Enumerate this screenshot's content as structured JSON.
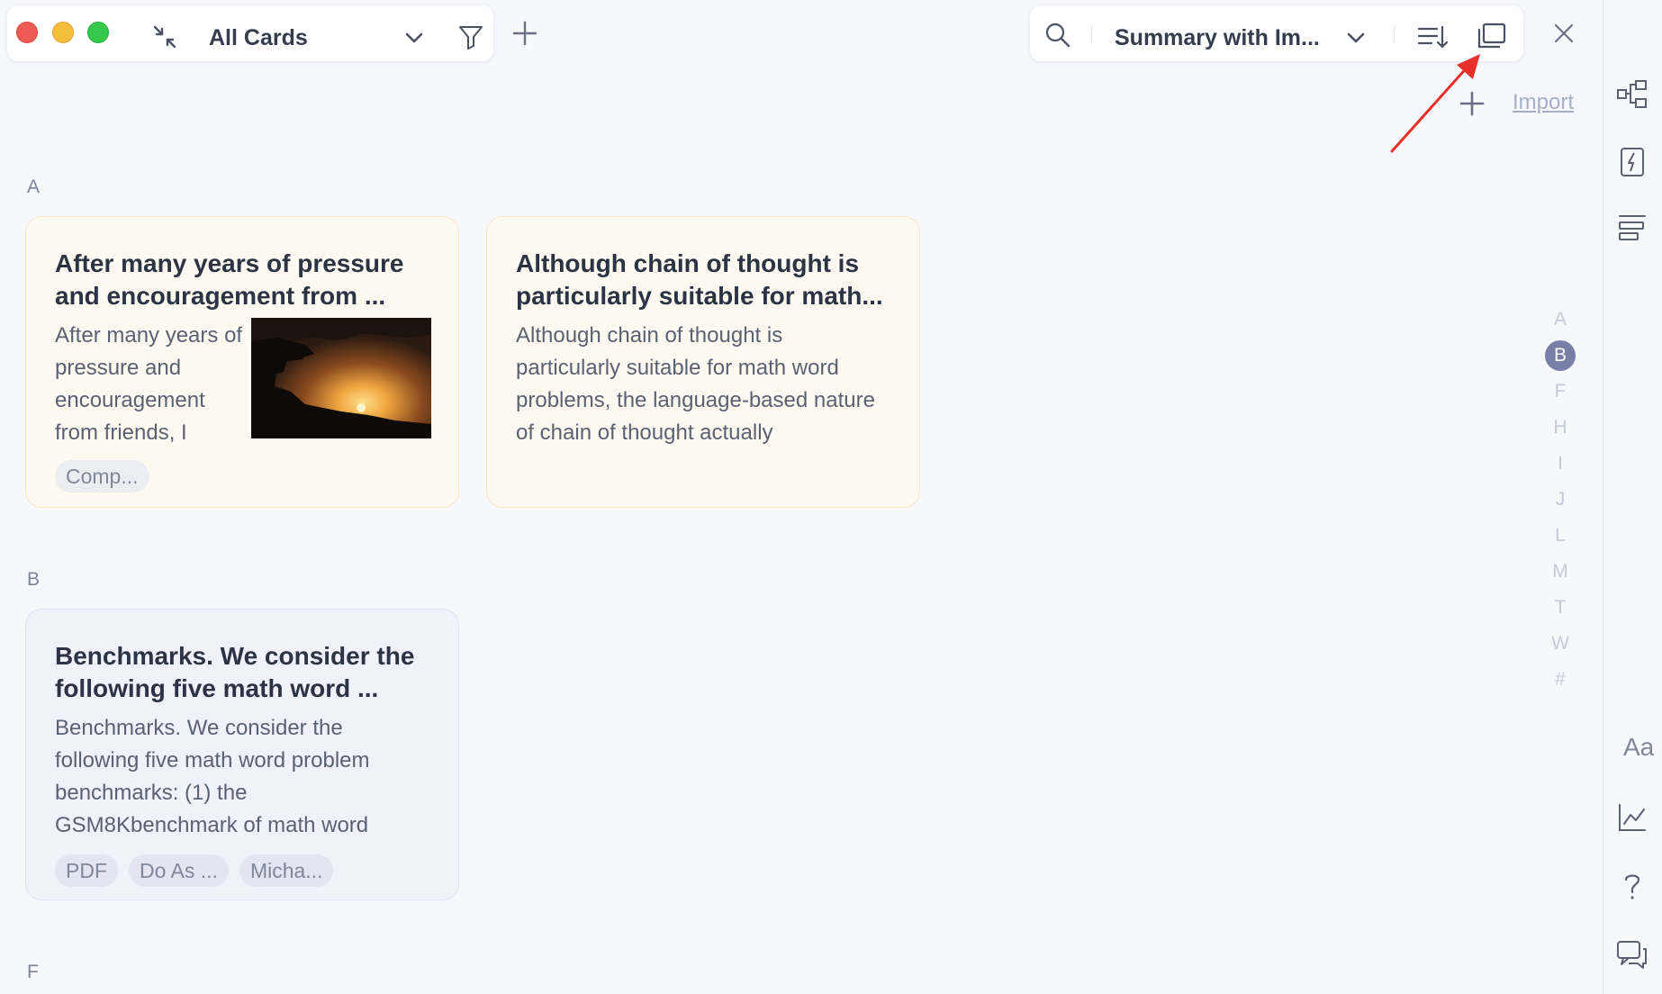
{
  "toolbar_left": {
    "view_title": "All Cards"
  },
  "toolbar_right": {
    "layout_title": "Summary with Im..."
  },
  "actions": {
    "import_label": "Import"
  },
  "sections": [
    {
      "letter": "A",
      "cards": [
        {
          "title": "After many years of pressure and encouragement from ...",
          "body": "After many years of pressure and encouragement from friends, I",
          "image": "sunset-silhouette",
          "tags": [
            "Comp..."
          ]
        },
        {
          "title": "Although chain of thought is particularly suitable for math...",
          "body": "Although chain of thought is particularly suitable for math word problems, the language-based nature of chain of thought actually",
          "tags": []
        }
      ]
    },
    {
      "letter": "B",
      "cards": [
        {
          "title": "Benchmarks. We consider the following five math word ...",
          "body": "Benchmarks. We consider the following five math word problem benchmarks: (1) the GSM8Kbenchmark of math word",
          "tags": [
            "PDF",
            "Do As ...",
            "Micha..."
          ]
        }
      ]
    },
    {
      "letter": "F",
      "cards": []
    }
  ],
  "alpha_index": {
    "letters": [
      "A",
      "B",
      "F",
      "H",
      "I",
      "J",
      "L",
      "M",
      "T",
      "W",
      "#"
    ],
    "active": "B"
  },
  "sidebar": {
    "font_label": "Aa",
    "icons": [
      "mindmap-icon",
      "flashcard-icon",
      "outline-icon",
      "font-icon",
      "chart-icon",
      "help-icon",
      "chat-icon"
    ]
  },
  "colors": {
    "background": "#f7f8fc",
    "card_yellow": "#fffaf1",
    "card_blue": "#f1f1fa",
    "active_index": "#7880a8",
    "annotation_arrow": "#e8302a"
  }
}
